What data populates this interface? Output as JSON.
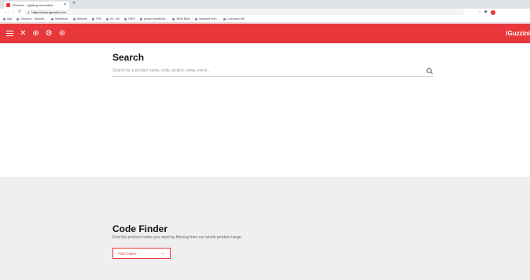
{
  "browser": {
    "tab_title": "iGuzzini - Lighting innovation",
    "new_tab": "+",
    "url": "https://www.iguzzini.com",
    "bookmarks": [
      "App",
      "Discover - intranet...",
      "Salesforce",
      "Network",
      "TMS",
      "IN - Intr",
      "HRIS",
      "project handbook...",
      "Work Base",
      "Imported from...",
      "Learning Hub"
    ]
  },
  "site": {
    "brand": "iGuzzini",
    "accent": "#e8383b"
  },
  "search": {
    "title": "Search",
    "placeholder": "Search for a product name, code, project, news, event..."
  },
  "code_finder": {
    "title": "Code Finder",
    "description": "Find the product codes you need by filtering from our whole product range.",
    "button_label": "Find Codes"
  }
}
